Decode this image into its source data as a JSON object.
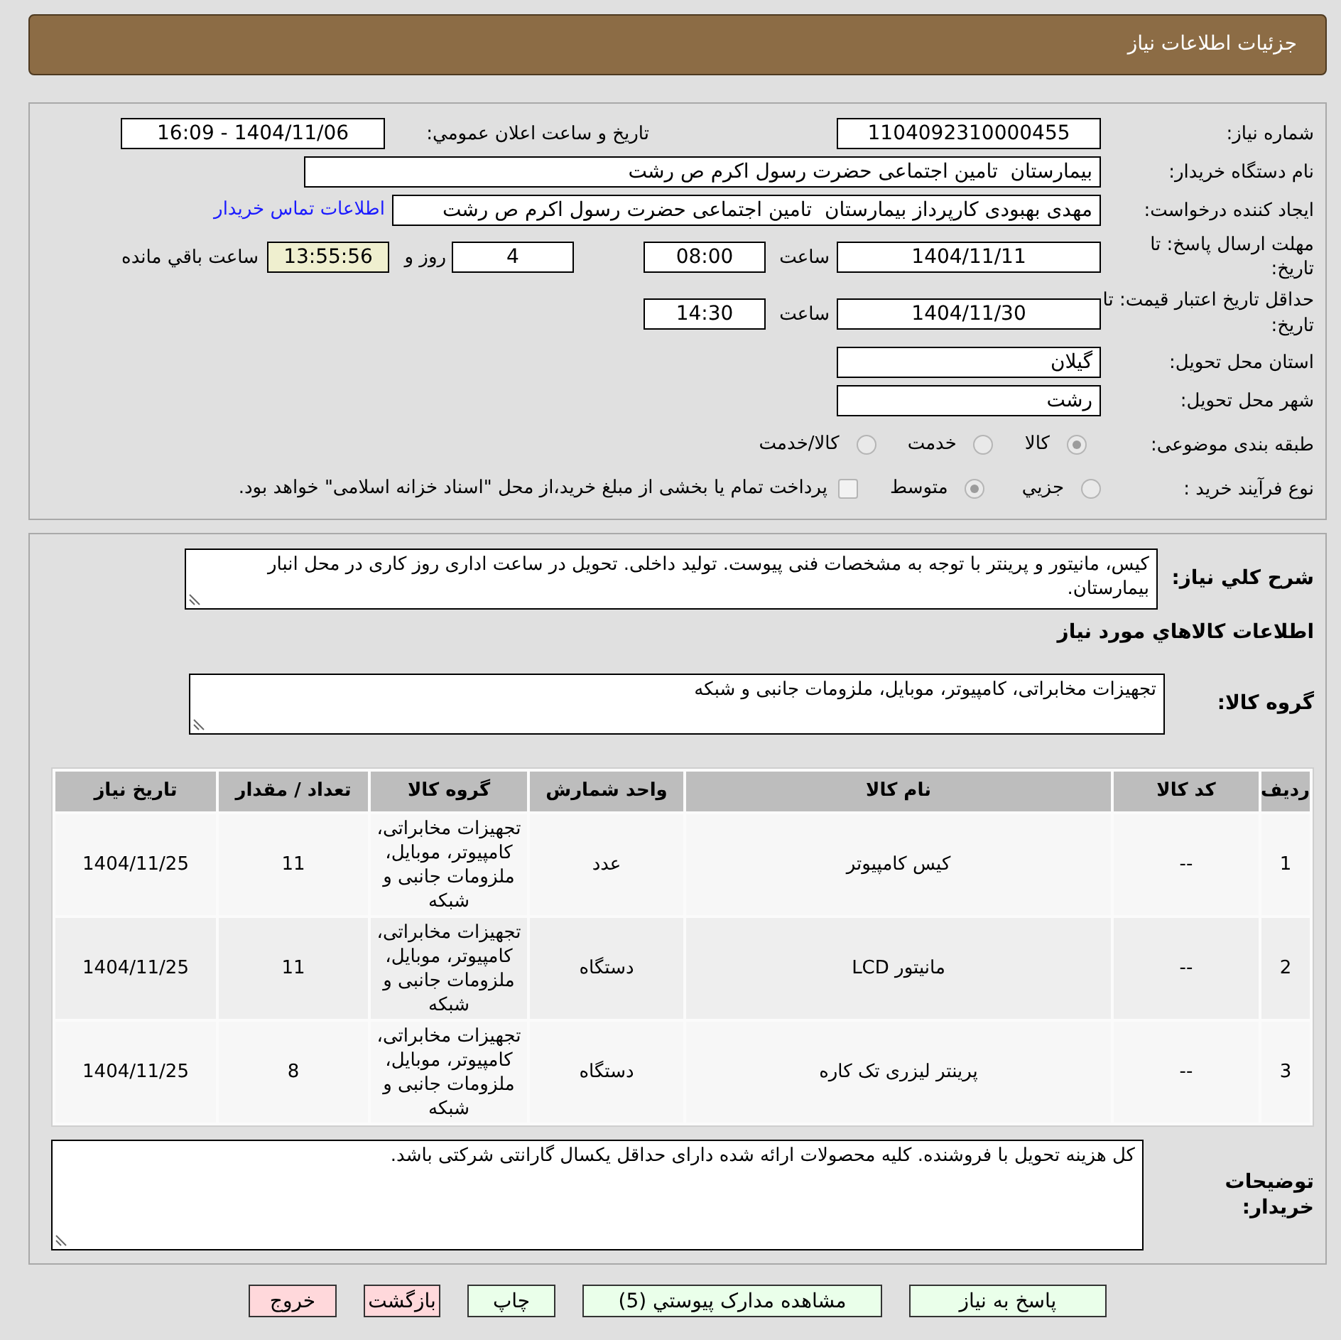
{
  "header": {
    "title": "جزئیات اطلاعات نیاز"
  },
  "details": {
    "need_number": {
      "label": "شماره نیاز:",
      "value": "1104092310000455"
    },
    "announcement": {
      "label": "تاریخ و ساعت اعلان عمومي:",
      "value": "1404/11/06 - 16:09"
    },
    "buyer_org": {
      "label": "نام دستگاه خريدار:",
      "value": "بیمارستان  تامین اجتماعی حضرت رسول اکرم ص رشت"
    },
    "requester": {
      "label": "ایجاد کننده درخواست:",
      "value": "مهدی بهبودی کارپرداز بیمارستان  تامین اجتماعی حضرت رسول اکرم ص رشت",
      "link": "اطلاعات تماس خريدار"
    },
    "response_deadline": {
      "label": "مهلت ارسال پاسخ: تا تاریخ:",
      "date": "1404/11/11",
      "time_label": "ساعت",
      "time": "08:00",
      "days": "4",
      "days_label": "روز و",
      "remaining": "13:55:56",
      "remaining_label": "ساعت باقي مانده"
    },
    "price_validity": {
      "label": "حداقل تاریخ اعتبار قیمت: تا تاریخ:",
      "date": "1404/11/30",
      "time_label": "ساعت",
      "time": "14:30"
    },
    "province": {
      "label": "استان محل تحویل:",
      "value": "گیلان"
    },
    "city": {
      "label": "شهر محل تحویل:",
      "value": "رشت"
    },
    "category": {
      "label": "طبقه بندی موضوعی:",
      "options": [
        {
          "label": "کالا",
          "selected": true
        },
        {
          "label": "خدمت",
          "selected": false
        },
        {
          "label": "کالا/خدمت",
          "selected": false
        }
      ]
    },
    "purchase_type": {
      "label": "نوع فرآیند خرید :",
      "options": [
        {
          "label": "جزيي",
          "selected": false
        },
        {
          "label": "متوسط",
          "selected": true
        }
      ],
      "treasury_option": {
        "label": "پرداخت تمام یا بخشی از مبلغ خرید،از محل \"اسناد خزانه اسلامی\" خواهد بود.",
        "checked": false
      }
    }
  },
  "description": {
    "label": "شرح کلي نیاز:",
    "value": "کیس، مانیتور و پرینتر با توجه به مشخصات فنی پیوست. تولید داخلی. تحویل در ساعت اداری روز کاری در محل انبار بیمارستان."
  },
  "goods": {
    "title": "اطلاعات کالاهاي مورد نیاز",
    "group": {
      "label": "گروه کالا:",
      "value": "تجهیزات مخابراتی، کامپیوتر، موبایل، ملزومات جانبی و شبکه"
    },
    "table": {
      "columns": [
        "ردیف",
        "کد کالا",
        "نام کالا",
        "واحد شمارش",
        "گروه کالا",
        "تعداد / مقدار",
        "تاریخ نیاز"
      ],
      "rows": [
        {
          "cells": [
            "1",
            "--",
            "کیس کامپیوتر",
            "عدد",
            "تجهیزات مخابراتی، کامپیوتر، موبایل، ملزومات جانبی و شبکه",
            "11",
            "1404/11/25"
          ]
        },
        {
          "cells": [
            "2",
            "--",
            "مانیتور LCD",
            "دستگاه",
            "تجهیزات مخابراتی، کامپیوتر، موبایل، ملزومات جانبی و شبکه",
            "11",
            "1404/11/25"
          ]
        },
        {
          "cells": [
            "3",
            "--",
            "پرینتر لیزری تک کاره",
            "دستگاه",
            "تجهیزات مخابراتی، کامپیوتر، موبایل، ملزومات جانبی و شبکه",
            "8",
            "1404/11/25"
          ]
        }
      ]
    }
  },
  "buyer_notes": {
    "label": "توضیحات خریدار:",
    "value": "کل هزینه تحویل با فروشنده. کلیه محصولات ارائه شده دارای حداقل یکسال گارانتی شرکتی باشد."
  },
  "buttons": [
    {
      "label": "پاسخ به نیاز",
      "kind": "action"
    },
    {
      "label": "مشاهده مدارک پیوستي (5)",
      "kind": "action"
    },
    {
      "label": "چاپ",
      "kind": "action"
    },
    {
      "label": "بازگشت",
      "kind": "exit"
    },
    {
      "label": "خروج",
      "kind": "exit"
    }
  ]
}
